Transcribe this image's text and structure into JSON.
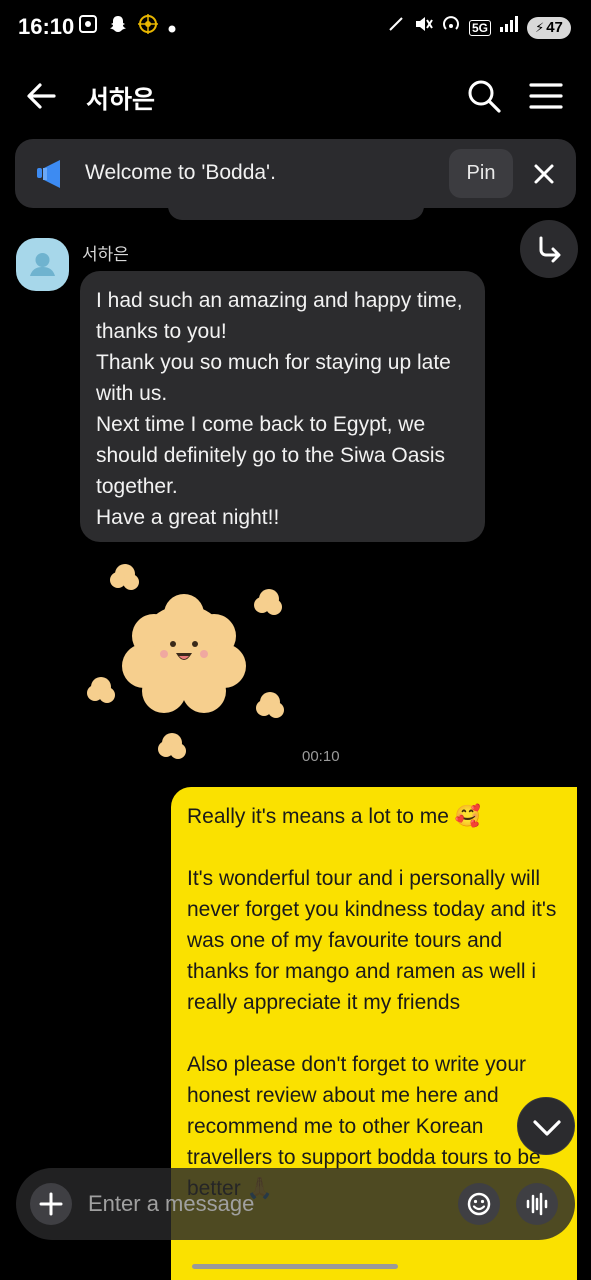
{
  "status_bar": {
    "time": "16:10",
    "network": "5G",
    "battery": "47"
  },
  "header": {
    "title": "서하은"
  },
  "notice": {
    "text": "Welcome to 'Bodda'.",
    "pin_label": "Pin"
  },
  "incoming": {
    "sender": "서하은",
    "text": "I had such an amazing and happy time, thanks to you!\nThank you so much for staying up late with us.\nNext time I come back to Egypt, we should definitely go to the Siwa Oasis together.\nHave a great night!!",
    "time": "00:10"
  },
  "outgoing": {
    "text": "Really it's means a lot to me 🥰\n\nIt's wonderful tour and i personally will never forget you kindness today and it's was one of my favourite tours and thanks for mango and ramen as well i really appreciate it my friends\n\nAlso please don't forget to write your honest review about me here and recommend me to other Korean travellers to support bodda tours to be better 🙏"
  },
  "composer": {
    "placeholder": "Enter a message"
  },
  "colors": {
    "background": "#000000",
    "incoming_bubble": "#2c2c2e",
    "outgoing_bubble": "#fae100",
    "avatar": "#a7d7ea",
    "notice_icon": "#3d8bf2"
  }
}
